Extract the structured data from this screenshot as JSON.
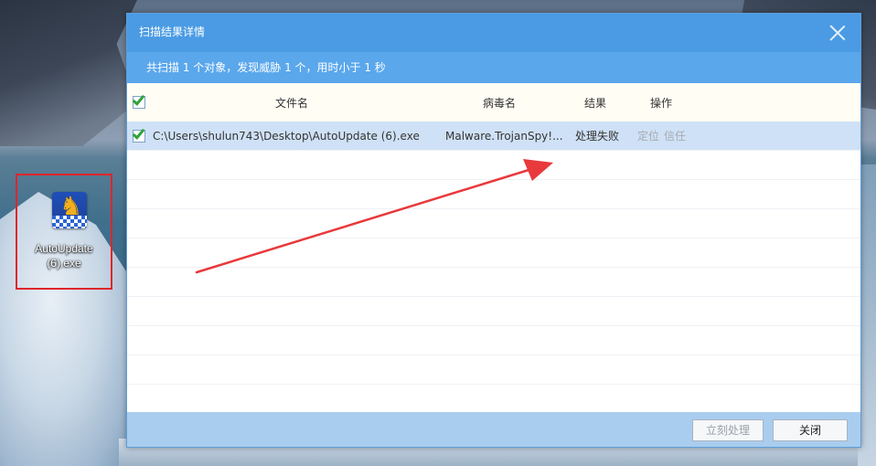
{
  "desktop": {
    "icon_label": "AutoUpdate (6).exe"
  },
  "dialog": {
    "title": "扫描结果详情",
    "summary": "共扫描 1 个对象，发现威胁 1 个，用时小于 1 秒",
    "columns": {
      "filename": "文件名",
      "virus_name": "病毒名",
      "result": "结果",
      "action": "操作"
    },
    "rows": [
      {
        "checked": true,
        "path": "C:\\Users\\shulun743\\Desktop\\AutoUpdate (6).exe",
        "virus": "Malware.TrojanSpy!...",
        "result": "处理失败",
        "action_locate": "定位",
        "action_trust": "信任"
      }
    ],
    "buttons": {
      "process_now": "立刻处理",
      "close": "关闭"
    }
  },
  "colors": {
    "titlebar": "#4a9be4",
    "summary_bar": "#5aa7ec",
    "selected_row": "#cfe1f6",
    "footer": "#a9cdef",
    "annotation_red": "#e0252b"
  }
}
